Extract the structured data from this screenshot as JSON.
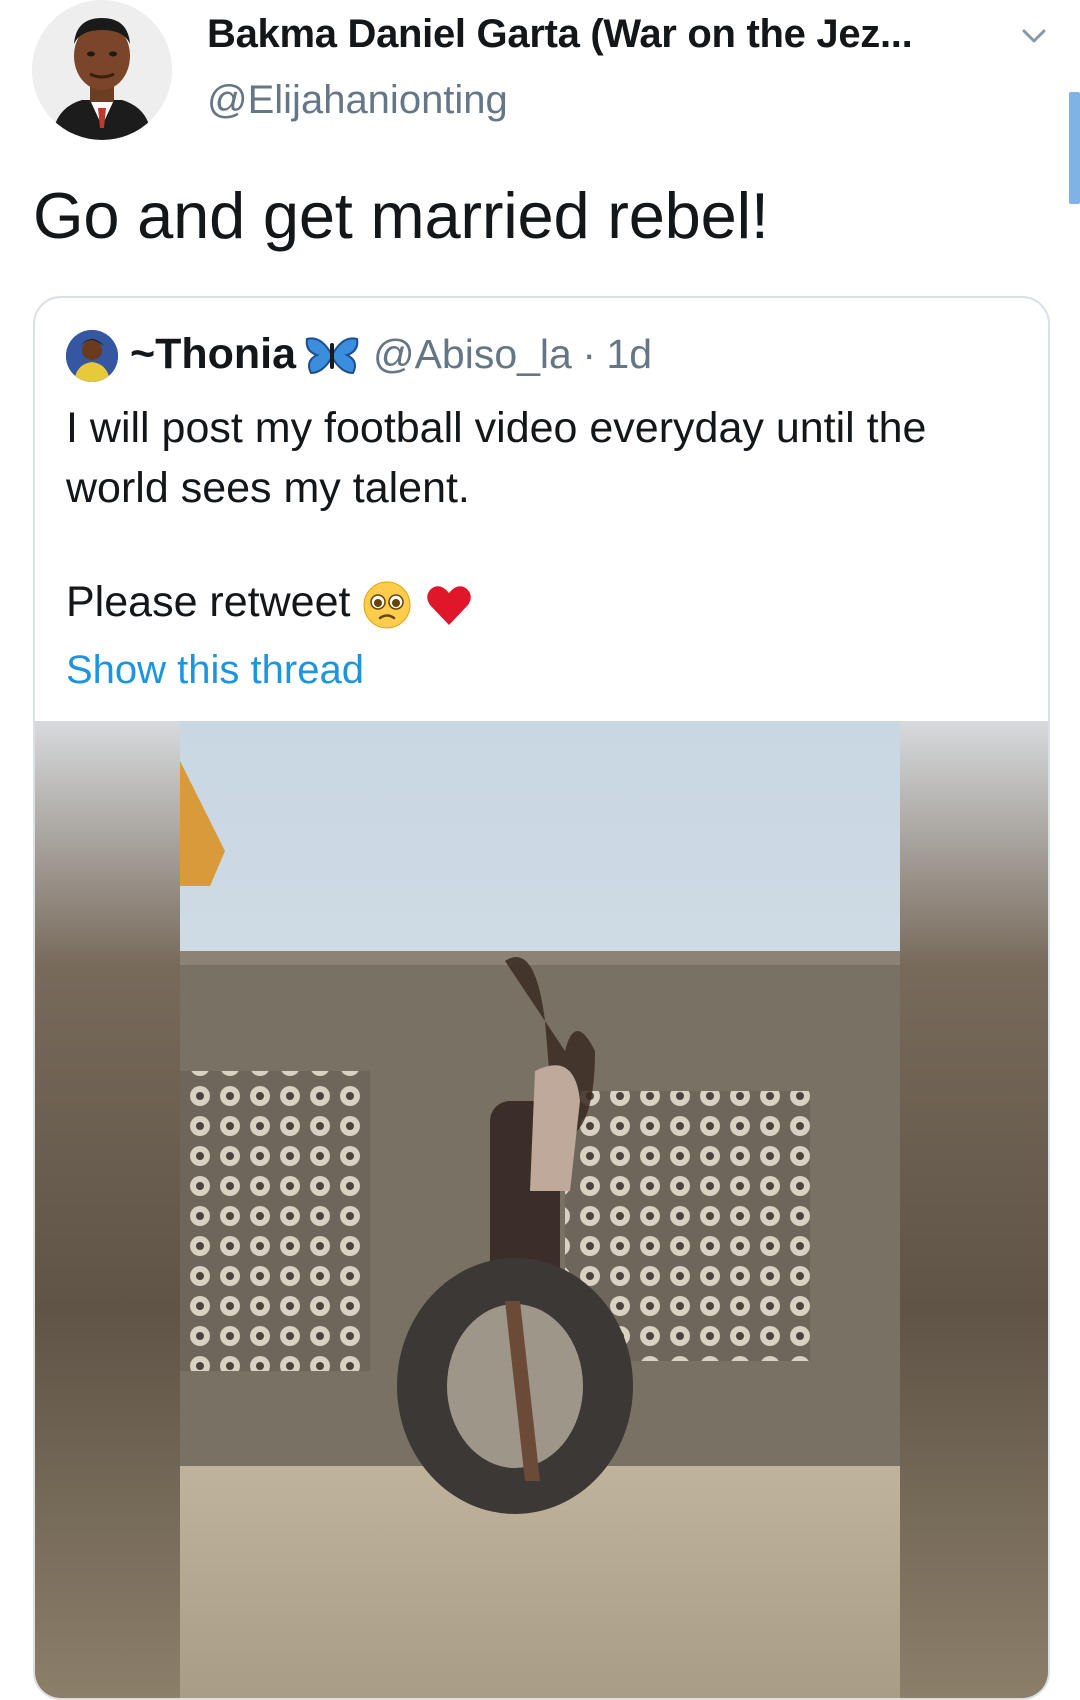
{
  "tweet": {
    "author_name": "Bakma Daniel Garta (War on the Jez...",
    "author_handle": "@Elijahanionting",
    "text": "Go and get married rebel!",
    "icons": {
      "avatar": "avatar-photo",
      "more": "chevron-down-icon"
    }
  },
  "quoted": {
    "name": "~Thonia",
    "name_emoji": "butterfly-emoji",
    "handle": "@Abiso_la",
    "separator": "·",
    "time": "1d",
    "body_line1": "I will post my football video everyday until the",
    "body_line2": "world sees my talent.",
    "retweet_text": "Please retweet",
    "retweet_emojis": [
      "pleading-face-emoji",
      "red-heart-emoji"
    ],
    "show_thread": "Show this thread",
    "media": "video-thumbnail"
  },
  "colors": {
    "link": "#1b95e0",
    "secondary_text": "#657786",
    "border": "#d9e0e6",
    "primary_text": "#14171a"
  }
}
